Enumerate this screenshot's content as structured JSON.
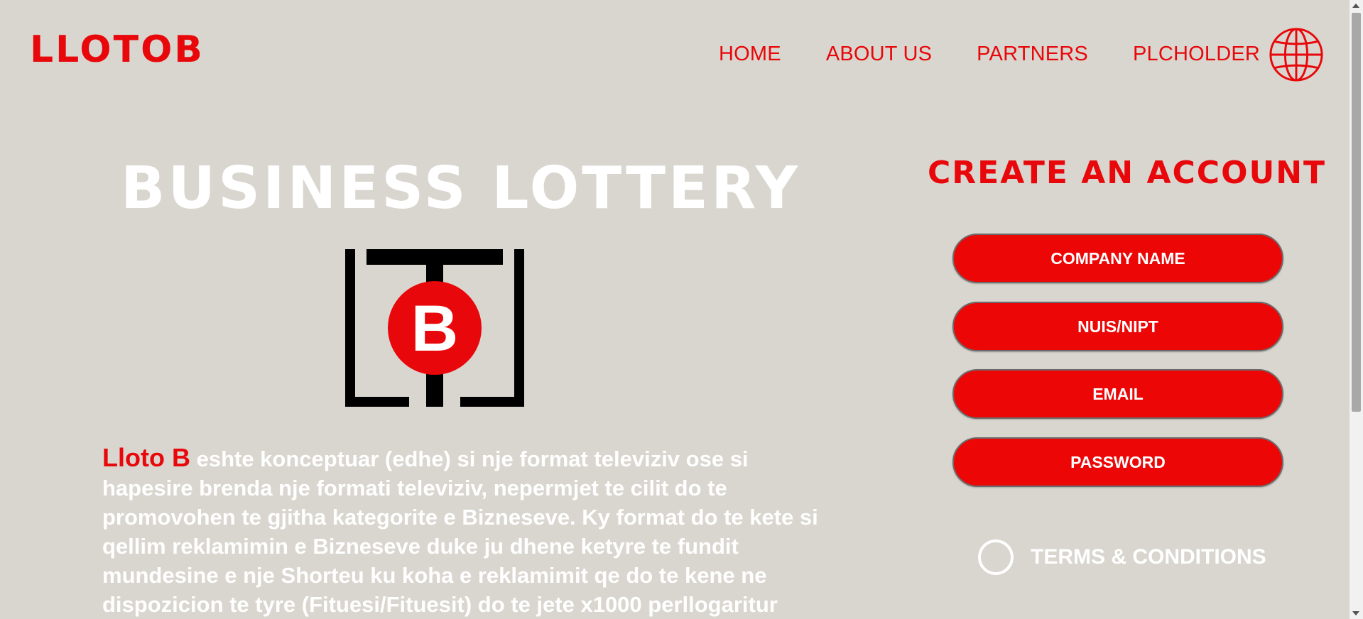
{
  "header": {
    "logo": "LLOTOB",
    "nav": [
      "HOME",
      "ABOUT US",
      "PARTNERS",
      "PLCHOLDER"
    ],
    "globe_icon": "globe-icon"
  },
  "hero": {
    "title": "BUSINESS LOTTERY",
    "logo_letter": "B",
    "brand": "Lloto B",
    "description": " eshte konceptuar (edhe) si nje format televiziv ose si hapesire brenda nje formati televiziv, nepermjet te cilit do te promovohen te gjitha kategorite e Bizneseve. Ky format do te kete si qellim reklamimin e Bizneseve duke ju dhene ketyre te fundit mundesine e nje Shorteu ku koha e reklamimit qe do te kene ne dispozicion te tyre (Fituesi/Fituesit) do te jete x1000 perllogaritur"
  },
  "form": {
    "title": "CREATE AN ACCOUNT",
    "company_placeholder": "COMPANY NAME",
    "nuis_placeholder": "NUIS/NIPT",
    "email_placeholder": "EMAIL",
    "password_placeholder": "PASSWORD",
    "terms_label": "TERMS & CONDITIONS"
  },
  "colors": {
    "accent": "#e8070a",
    "background": "#d9d6cf",
    "text_light": "#ffffff"
  }
}
